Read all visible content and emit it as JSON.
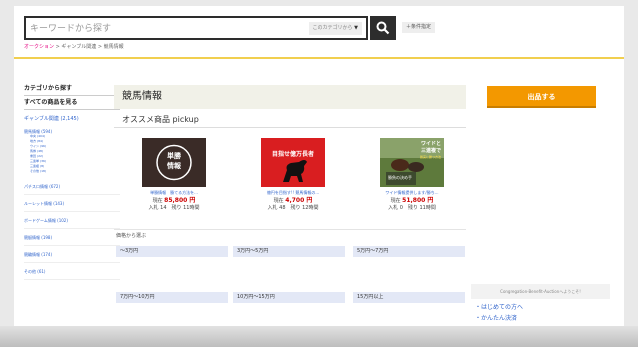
{
  "search": {
    "placeholder": "キーワードから探す",
    "category_label": "このカテゴリから",
    "cond_label": "＋条件指定"
  },
  "breadcrumb": {
    "root": "オークション",
    "sep1": ">",
    "level1": "ギャンブル関連",
    "sep2": ">",
    "current": "競馬情報"
  },
  "sidebar": {
    "find_by_category": "カテゴリから探す",
    "all_items": "すべての商品を見る",
    "category": "ギャンブル関連 (2,145)",
    "subcategory": "競馬情報 (594)",
    "sub_items": [
      "中央 (404)",
      "地方 (84)",
      "ウイン (96)",
      "馬券 (48)",
      "重賞 (22)",
      "三連単 (36)",
      "三連複 (8)",
      "その他 (18)"
    ],
    "links": [
      "パチスロ情報 (672)",
      "ルーレット情報 (143)",
      "ボードゲーム情報 (102)",
      "競艇情報 (198)",
      "競輪情報 (174)",
      "その他 (61)"
    ]
  },
  "main": {
    "title": "競馬情報",
    "pickup_title": "オススメ商品 pickup",
    "price_search_label": "価格から選ぶ",
    "price_ranges": [
      "〜3万円",
      "3万円〜5万円",
      "5万円〜7万円",
      "7万円〜10万円",
      "10万円〜15万円",
      "15万円以上"
    ]
  },
  "pickup_items": [
    {
      "thumb_text_1": "単勝",
      "thumb_text_2": "情報",
      "name": "単勝情報　勝てる方法を...",
      "price_label": "現在",
      "price": "85,800 円",
      "meta": "入札 14　残り 11時間"
    },
    {
      "thumb_text_1": "目指せ億万長者",
      "name": "億円を目指す!! 競馬情報の...",
      "price_label": "現在",
      "price": "4,700 円",
      "meta": "入札 48　残り 12時間"
    },
    {
      "thumb_text_1": "ワイドと",
      "thumb_text_2": "三連複で",
      "thumb_text_3": "確実に勝つ方法",
      "thumb_text_4": "勝負の決め手",
      "name": "ワイド情報提供します/勝ち...",
      "price_label": "現在",
      "price": "51,800 円",
      "meta": "入札 0　残り 11時間"
    }
  ],
  "right": {
    "sell_button": "出品する",
    "welcome": "Congregation-Benefit-Auctionへようこそ!",
    "link_beginner": "・はじめての方へ",
    "link_payment": "・かんたん決済"
  },
  "colors": {
    "accent_orange": "#f39800",
    "gold_rule": "#f1cf4f",
    "link_blue": "#3366cc",
    "price_red": "#cc0000",
    "breadcrumb_pink": "#e4007f"
  }
}
